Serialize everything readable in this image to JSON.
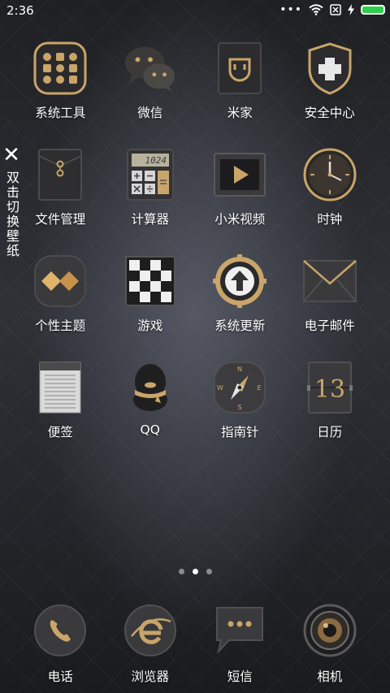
{
  "status_bar": {
    "time": "2:36",
    "more": "•••"
  },
  "side_hint": {
    "text": "双击切换壁纸"
  },
  "apps": [
    {
      "label": "系统工具",
      "icon": "tools-folder-icon"
    },
    {
      "label": "微信",
      "icon": "wechat-icon"
    },
    {
      "label": "米家",
      "icon": "mijia-icon"
    },
    {
      "label": "安全中心",
      "icon": "shield-icon"
    },
    {
      "label": "文件管理",
      "icon": "folder-envelope-icon"
    },
    {
      "label": "计算器",
      "icon": "calculator-icon",
      "display": "1024"
    },
    {
      "label": "小米视频",
      "icon": "video-play-icon"
    },
    {
      "label": "时钟",
      "icon": "clock-icon"
    },
    {
      "label": "个性主题",
      "icon": "theme-icon"
    },
    {
      "label": "游戏",
      "icon": "checkerboard-icon"
    },
    {
      "label": "系统更新",
      "icon": "update-gear-icon"
    },
    {
      "label": "电子邮件",
      "icon": "mail-envelope-icon"
    },
    {
      "label": "便签",
      "icon": "notes-icon"
    },
    {
      "label": "QQ",
      "icon": "qq-penguin-icon"
    },
    {
      "label": "指南针",
      "icon": "compass-icon",
      "directions": [
        "N",
        "E",
        "S",
        "W"
      ]
    },
    {
      "label": "日历",
      "icon": "calendar-icon",
      "date": "13"
    }
  ],
  "page_indicator": {
    "count": 3,
    "active": 1
  },
  "dock": [
    {
      "label": "电话",
      "icon": "phone-icon"
    },
    {
      "label": "浏览器",
      "icon": "browser-icon"
    },
    {
      "label": "短信",
      "icon": "message-icon"
    },
    {
      "label": "相机",
      "icon": "camera-icon"
    }
  ],
  "colors": {
    "gold": "#c9a56a",
    "dark": "#2b2b2e",
    "battery": "#2ecf4e"
  }
}
